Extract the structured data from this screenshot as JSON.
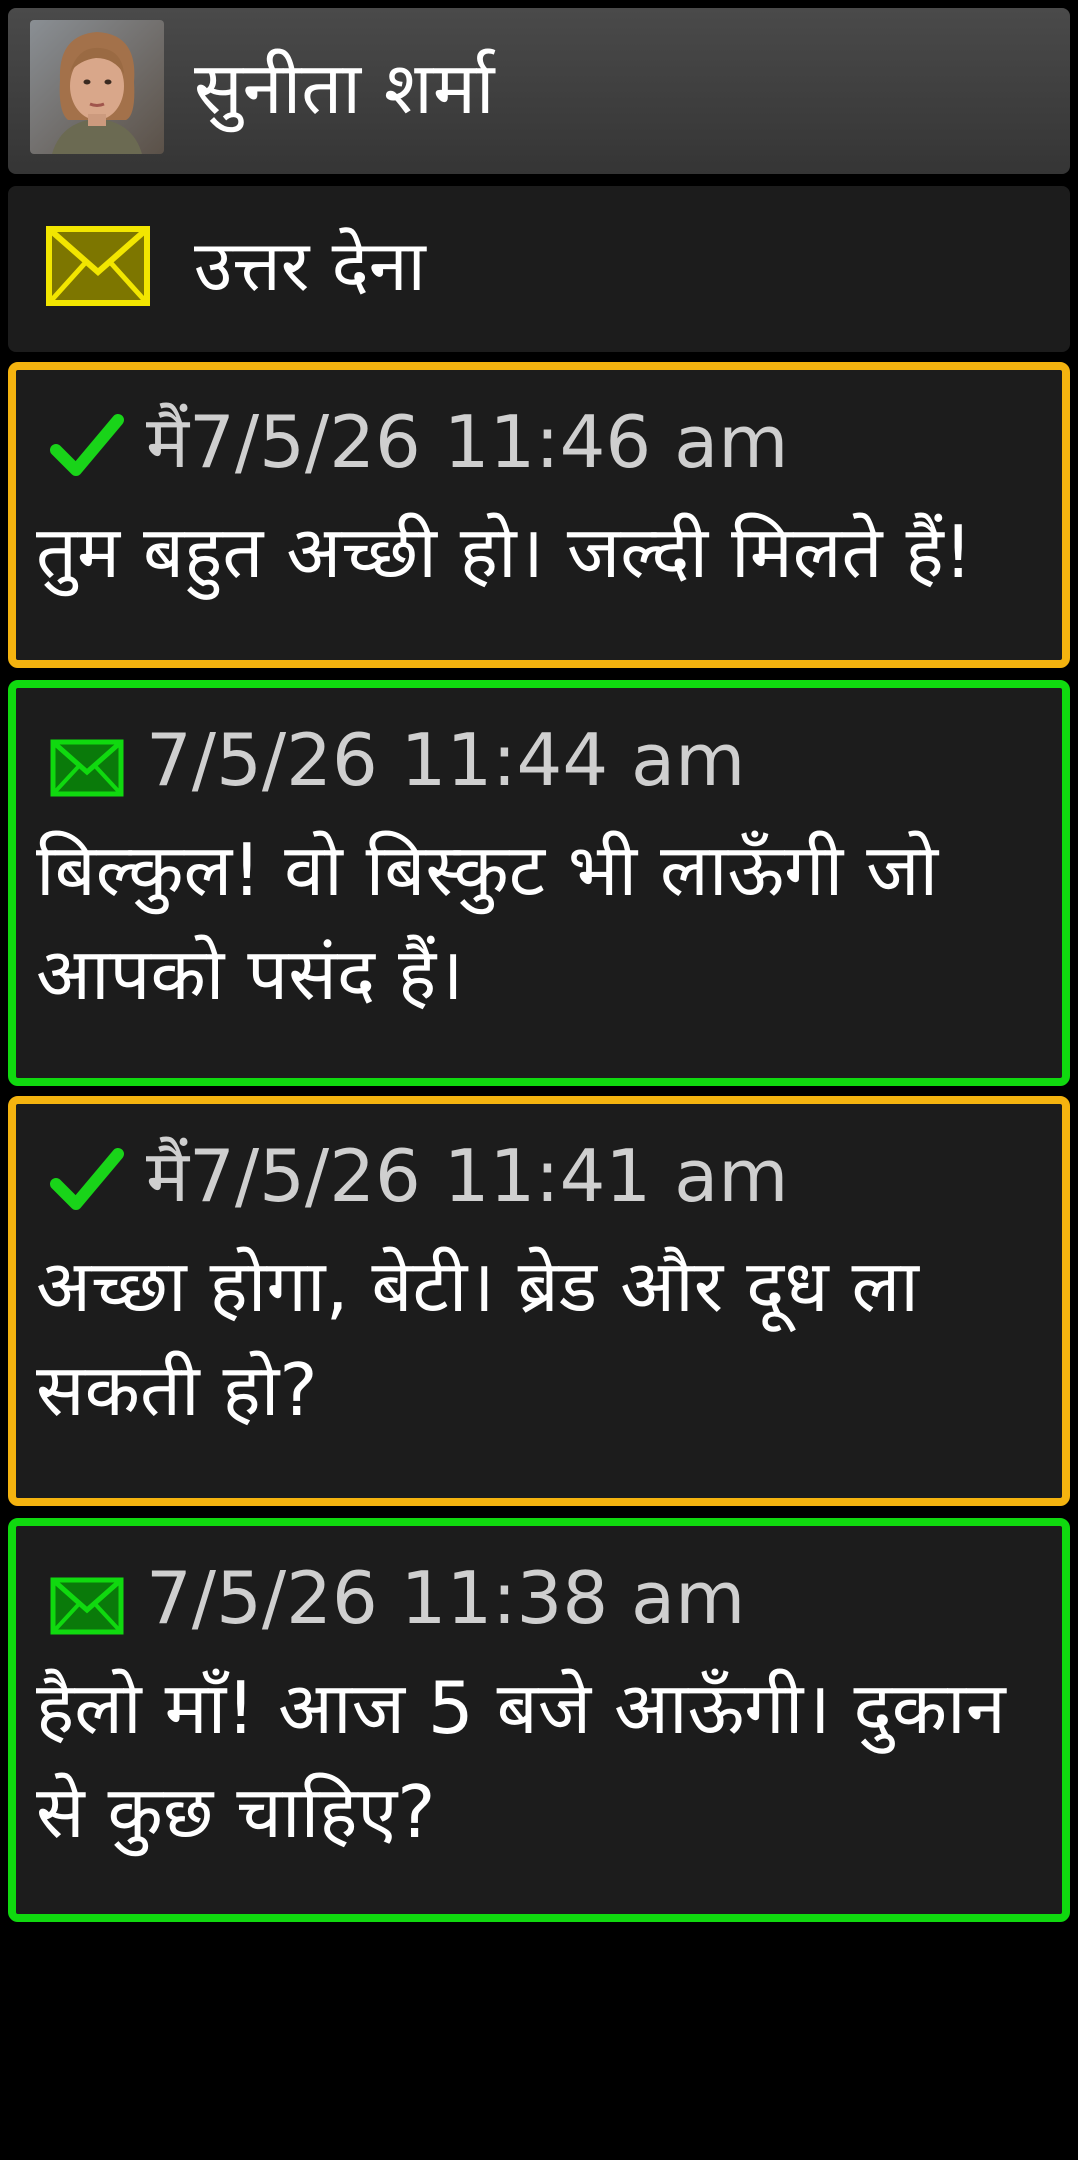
{
  "header": {
    "contact_name": "सुनीता शर्मा",
    "avatar_icon": "avatar-photo"
  },
  "reply": {
    "label": "उत्तर देना",
    "icon": "envelope-icon",
    "icon_color": "#e8e000"
  },
  "colors": {
    "sent_border": "#f4b30f",
    "received_border": "#10d90f",
    "check": "#19d419",
    "envelope_received": "#10d90f",
    "background": "#000000",
    "panel": "#1c1c1c"
  },
  "messages": [
    {
      "direction": "sent",
      "status_icon": "check-icon",
      "meta": "मैं7/5/26 11:46 am",
      "text": "तुम बहुत अच्छी हो। जल्दी मिलते हैं!"
    },
    {
      "direction": "received",
      "status_icon": "envelope-icon",
      "meta": "7/5/26 11:44 am",
      "text": "बिल्कुल! वो बिस्कुट भी लाऊँगी जो आपको पसंद हैं।"
    },
    {
      "direction": "sent",
      "status_icon": "check-icon",
      "meta": "मैं7/5/26 11:41 am",
      "text": "अच्छा होगा, बेटी। ब्रेड और दूध ला सकती हो?"
    },
    {
      "direction": "received",
      "status_icon": "envelope-icon",
      "meta": "7/5/26 11:38 am",
      "text": "हैलो माँ! आज 5 बजे आऊँगी। दुकान से कुछ चाहिए?"
    }
  ]
}
